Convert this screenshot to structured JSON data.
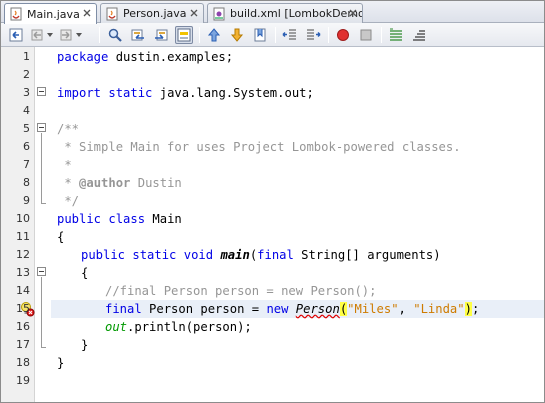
{
  "tabs": [
    {
      "label": "Main.java",
      "active": true,
      "icon": "java-file-icon"
    },
    {
      "label": "Person.java",
      "active": false,
      "icon": "java-file-icon"
    },
    {
      "label": "build.xml [LombokDemo]",
      "active": false,
      "icon": "ant-file-icon"
    }
  ],
  "toolbar": {
    "buttons": [
      "last-edit-icon",
      "back-icon",
      "forward-icon",
      "find-icon",
      "find-previous-icon",
      "find-next-icon",
      "toggle-highlight-search-icon",
      "previous-bookmark-icon",
      "next-bookmark-icon",
      "toggle-bookmark-icon",
      "shift-left-icon",
      "shift-right-icon",
      "start-macro-icon",
      "stop-macro-icon",
      "comment-icon",
      "uncomment-icon"
    ]
  },
  "editor": {
    "line_numbers": [
      "1",
      "2",
      "3",
      "4",
      "5",
      "6",
      "7",
      "8",
      "9",
      "10",
      "11",
      "12",
      "13",
      "14",
      "15",
      "16",
      "17",
      "18",
      "19"
    ],
    "lines": {
      "l1": {
        "kw": "package",
        "rest": " dustin.examples;"
      },
      "l3": {
        "kw1": "import",
        "kw2": "static",
        "rest": " java.lang.System.out;"
      },
      "l5": "/**",
      "l6": " * Simple Main for uses Project Lombok-powered classes.",
      "l7": " *",
      "l8_prefix": " * ",
      "l8_tag": "@author",
      "l8_rest": " Dustin",
      "l9": " */",
      "l10": {
        "kw1": "public",
        "kw2": "class",
        "rest": " Main"
      },
      "l11": "{",
      "l12": {
        "kw1": "public",
        "kw2": "static",
        "kw3": "void",
        "method": "main",
        "open": "(",
        "kw4": "final",
        "rest": " String[] arguments)"
      },
      "l13": "{",
      "l14": "//final Person person = new Person();",
      "l15": {
        "kw1": "final",
        "mid": " Person person = ",
        "kw2": "new",
        "cls": "Person",
        "open": "(",
        "s1": "\"Miles\"",
        "sep": ", ",
        "s2": "\"Linda\"",
        "close": ")",
        "end": ";"
      },
      "l16": {
        "field": "out",
        "rest": ".println(person);"
      },
      "l17": "}",
      "l18": "}"
    },
    "error_marker_line": 15
  }
}
